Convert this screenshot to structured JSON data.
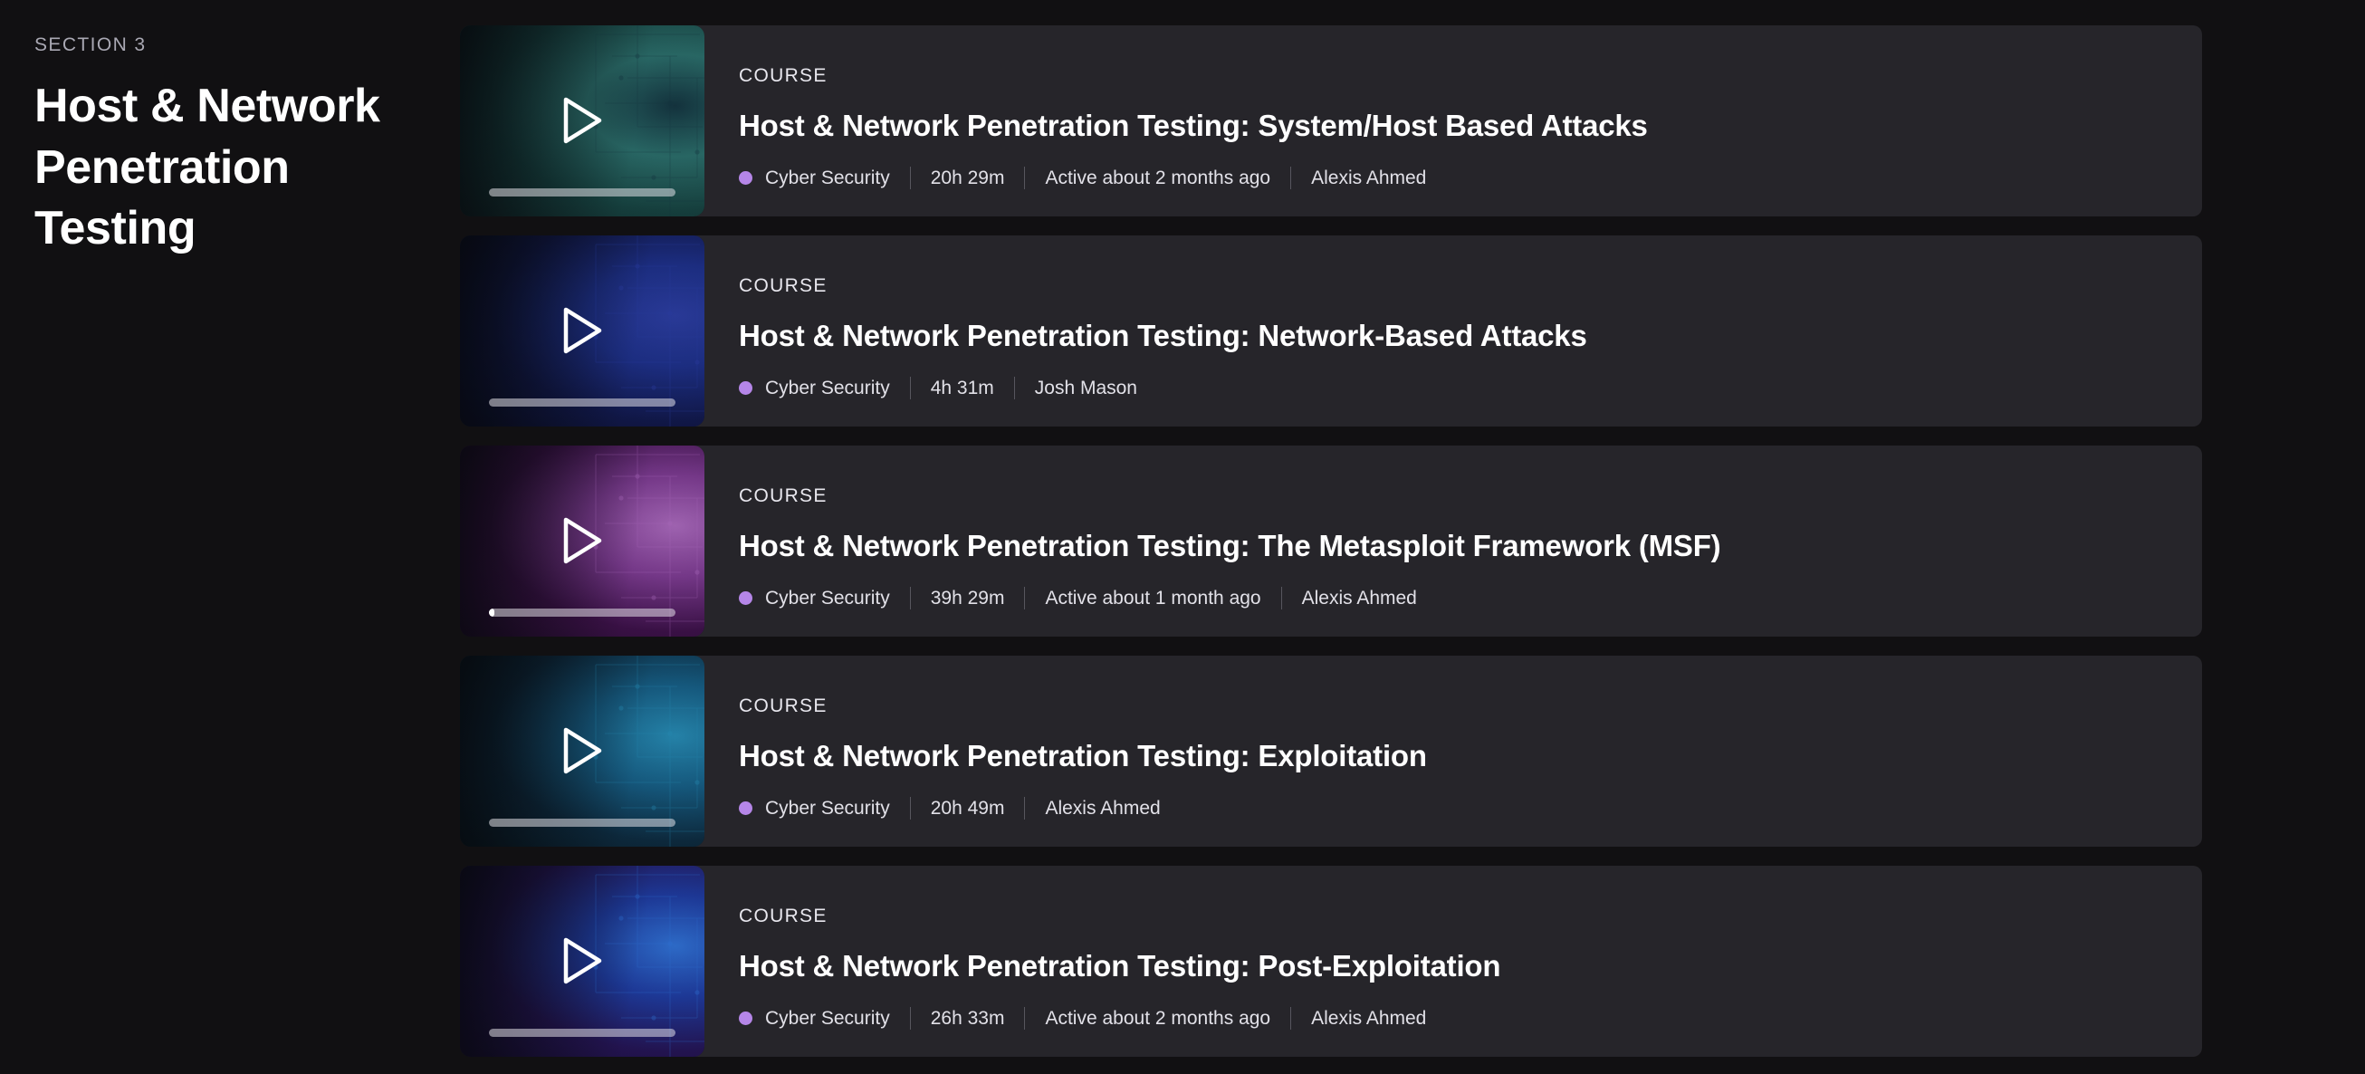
{
  "theme": {
    "page_background": "#111012",
    "card_background": "#26252a",
    "accent_dot": "#b586e8",
    "title_color": "#ffffff",
    "meta_color": "#e2e1e8"
  },
  "sidebar": {
    "eyebrow": "SECTION 3",
    "title": "Host & Network Penetration Testing"
  },
  "courses": [
    {
      "kicker": "COURSE",
      "title": "Host & Network Penetration Testing: System/Host Based Attacks",
      "category": "Cyber Security",
      "duration": "20h 29m",
      "activity": "Active about 2 months ago",
      "instructor": "Alexis Ahmed",
      "play_icon": "play-icon",
      "progress_percent": 0,
      "thumb_colors": [
        "#0e1a1c",
        "#16413f",
        "#2a6b68",
        "#14343f"
      ]
    },
    {
      "kicker": "COURSE",
      "title": "Host & Network Penetration Testing: Network-Based Attacks",
      "category": "Cyber Security",
      "duration": "4h 31m",
      "activity": "",
      "instructor": "Josh Mason",
      "play_icon": "play-icon",
      "progress_percent": 0,
      "thumb_colors": [
        "#080a1a",
        "#11184a",
        "#1d2f86",
        "#2b3c9e"
      ]
    },
    {
      "kicker": "COURSE",
      "title": "Host & Network Penetration Testing: The Metasploit Framework (MSF)",
      "category": "Cyber Security",
      "duration": "39h 29m",
      "activity": "Active about 1 month ago",
      "instructor": "Alexis Ahmed",
      "play_icon": "play-icon",
      "progress_percent": 3,
      "thumb_colors": [
        "#190a22",
        "#3c1148",
        "#7a3a8e",
        "#a667b8"
      ]
    },
    {
      "kicker": "COURSE",
      "title": "Host & Network Penetration Testing: Exploitation",
      "category": "Cyber Security",
      "duration": "20h 49m",
      "activity": "",
      "instructor": "Alexis Ahmed",
      "play_icon": "play-icon",
      "progress_percent": 0,
      "thumb_colors": [
        "#071217",
        "#0d2a3e",
        "#165c82",
        "#2688b0"
      ]
    },
    {
      "kicker": "COURSE",
      "title": "Host & Network Penetration Testing: Post-Exploitation",
      "category": "Cyber Security",
      "duration": "26h 33m",
      "activity": "Active about 2 months ago",
      "instructor": "Alexis Ahmed",
      "play_icon": "play-icon",
      "progress_percent": 0,
      "thumb_colors": [
        "#140b26",
        "#241453",
        "#1e3a9c",
        "#2f6fd0"
      ]
    }
  ]
}
